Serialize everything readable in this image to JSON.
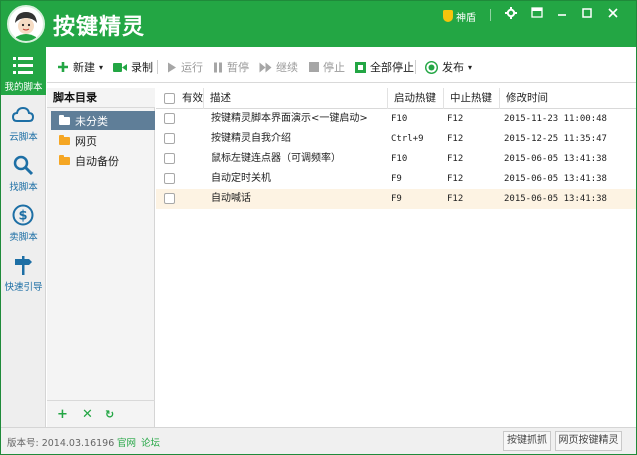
{
  "app": {
    "title": "按键精灵"
  },
  "titlebar": {
    "shield_label": "神盾"
  },
  "nav": [
    {
      "label": "我的脚本",
      "icon": "list-icon",
      "active": true
    },
    {
      "label": "云脚本",
      "icon": "cloud-icon"
    },
    {
      "label": "找脚本",
      "icon": "search-icon"
    },
    {
      "label": "卖脚本",
      "icon": "dollar-icon"
    },
    {
      "label": "快速引导",
      "icon": "signpost-icon"
    }
  ],
  "toolbar": {
    "new_label": "新建",
    "record_label": "录制",
    "run_label": "运行",
    "pause_label": "暂停",
    "continue_label": "继续",
    "stop_label": "停止",
    "stop_all_label": "全部停止",
    "publish_label": "发布"
  },
  "dir": {
    "title": "脚本目录",
    "items": [
      {
        "label": "未分类",
        "selected": true
      },
      {
        "label": "网页"
      },
      {
        "label": "自动备份"
      }
    ]
  },
  "table": {
    "headers": [
      "有效",
      "描述",
      "启动热键",
      "中止热键",
      "修改时间"
    ],
    "rows": [
      {
        "desc": "按键精灵脚本界面演示<一键启动>",
        "start": "F10",
        "stop": "F12",
        "time": "2015-11-23 11:00:48"
      },
      {
        "desc": "按键精灵自我介绍",
        "start": "Ctrl+9",
        "stop": "F12",
        "time": "2015-12-25 11:35:47"
      },
      {
        "desc": "鼠标左键连点器（可调频率）",
        "start": "F10",
        "stop": "F12",
        "time": "2015-06-05 13:41:38"
      },
      {
        "desc": "自动定时关机",
        "start": "F9",
        "stop": "F12",
        "time": "2015-06-05 13:41:38"
      },
      {
        "desc": "自动喊话",
        "start": "F9",
        "stop": "F12",
        "time": "2015-06-05 13:41:38"
      }
    ]
  },
  "status": {
    "version": "版本号: 2014.03.16196",
    "link_official": "官网",
    "link_forum": "论坛",
    "btn_capture": "按键抓抓",
    "btn_web": "网页按键精灵"
  },
  "colors": {
    "brand": "#23a644",
    "selected": "#5f7e98",
    "highlight_row": "#fdf3e3"
  }
}
